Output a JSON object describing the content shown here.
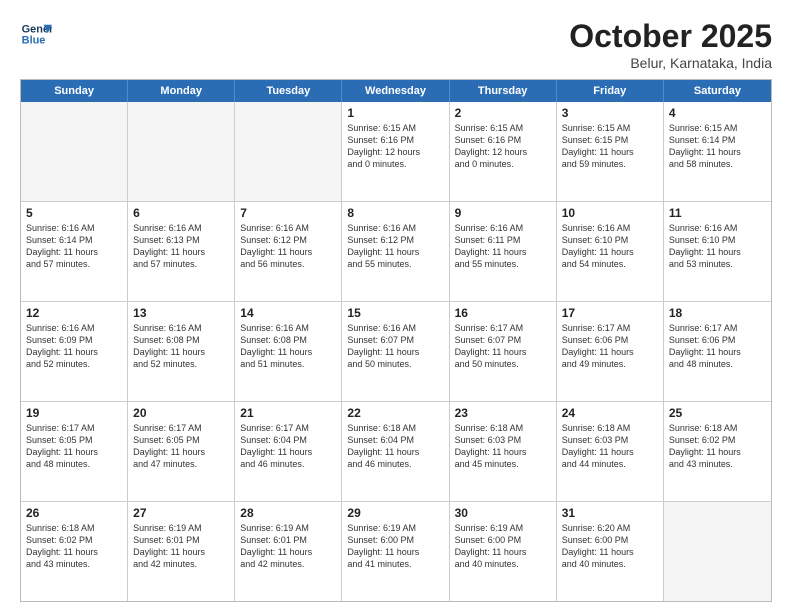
{
  "logo": {
    "line1": "General",
    "line2": "Blue"
  },
  "header": {
    "month": "October 2025",
    "location": "Belur, Karnataka, India"
  },
  "weekdays": [
    "Sunday",
    "Monday",
    "Tuesday",
    "Wednesday",
    "Thursday",
    "Friday",
    "Saturday"
  ],
  "weeks": [
    [
      {
        "day": "",
        "info": ""
      },
      {
        "day": "",
        "info": ""
      },
      {
        "day": "",
        "info": ""
      },
      {
        "day": "1",
        "info": "Sunrise: 6:15 AM\nSunset: 6:16 PM\nDaylight: 12 hours\nand 0 minutes."
      },
      {
        "day": "2",
        "info": "Sunrise: 6:15 AM\nSunset: 6:16 PM\nDaylight: 12 hours\nand 0 minutes."
      },
      {
        "day": "3",
        "info": "Sunrise: 6:15 AM\nSunset: 6:15 PM\nDaylight: 11 hours\nand 59 minutes."
      },
      {
        "day": "4",
        "info": "Sunrise: 6:15 AM\nSunset: 6:14 PM\nDaylight: 11 hours\nand 58 minutes."
      }
    ],
    [
      {
        "day": "5",
        "info": "Sunrise: 6:16 AM\nSunset: 6:14 PM\nDaylight: 11 hours\nand 57 minutes."
      },
      {
        "day": "6",
        "info": "Sunrise: 6:16 AM\nSunset: 6:13 PM\nDaylight: 11 hours\nand 57 minutes."
      },
      {
        "day": "7",
        "info": "Sunrise: 6:16 AM\nSunset: 6:12 PM\nDaylight: 11 hours\nand 56 minutes."
      },
      {
        "day": "8",
        "info": "Sunrise: 6:16 AM\nSunset: 6:12 PM\nDaylight: 11 hours\nand 55 minutes."
      },
      {
        "day": "9",
        "info": "Sunrise: 6:16 AM\nSunset: 6:11 PM\nDaylight: 11 hours\nand 55 minutes."
      },
      {
        "day": "10",
        "info": "Sunrise: 6:16 AM\nSunset: 6:10 PM\nDaylight: 11 hours\nand 54 minutes."
      },
      {
        "day": "11",
        "info": "Sunrise: 6:16 AM\nSunset: 6:10 PM\nDaylight: 11 hours\nand 53 minutes."
      }
    ],
    [
      {
        "day": "12",
        "info": "Sunrise: 6:16 AM\nSunset: 6:09 PM\nDaylight: 11 hours\nand 52 minutes."
      },
      {
        "day": "13",
        "info": "Sunrise: 6:16 AM\nSunset: 6:08 PM\nDaylight: 11 hours\nand 52 minutes."
      },
      {
        "day": "14",
        "info": "Sunrise: 6:16 AM\nSunset: 6:08 PM\nDaylight: 11 hours\nand 51 minutes."
      },
      {
        "day": "15",
        "info": "Sunrise: 6:16 AM\nSunset: 6:07 PM\nDaylight: 11 hours\nand 50 minutes."
      },
      {
        "day": "16",
        "info": "Sunrise: 6:17 AM\nSunset: 6:07 PM\nDaylight: 11 hours\nand 50 minutes."
      },
      {
        "day": "17",
        "info": "Sunrise: 6:17 AM\nSunset: 6:06 PM\nDaylight: 11 hours\nand 49 minutes."
      },
      {
        "day": "18",
        "info": "Sunrise: 6:17 AM\nSunset: 6:06 PM\nDaylight: 11 hours\nand 48 minutes."
      }
    ],
    [
      {
        "day": "19",
        "info": "Sunrise: 6:17 AM\nSunset: 6:05 PM\nDaylight: 11 hours\nand 48 minutes."
      },
      {
        "day": "20",
        "info": "Sunrise: 6:17 AM\nSunset: 6:05 PM\nDaylight: 11 hours\nand 47 minutes."
      },
      {
        "day": "21",
        "info": "Sunrise: 6:17 AM\nSunset: 6:04 PM\nDaylight: 11 hours\nand 46 minutes."
      },
      {
        "day": "22",
        "info": "Sunrise: 6:18 AM\nSunset: 6:04 PM\nDaylight: 11 hours\nand 46 minutes."
      },
      {
        "day": "23",
        "info": "Sunrise: 6:18 AM\nSunset: 6:03 PM\nDaylight: 11 hours\nand 45 minutes."
      },
      {
        "day": "24",
        "info": "Sunrise: 6:18 AM\nSunset: 6:03 PM\nDaylight: 11 hours\nand 44 minutes."
      },
      {
        "day": "25",
        "info": "Sunrise: 6:18 AM\nSunset: 6:02 PM\nDaylight: 11 hours\nand 43 minutes."
      }
    ],
    [
      {
        "day": "26",
        "info": "Sunrise: 6:18 AM\nSunset: 6:02 PM\nDaylight: 11 hours\nand 43 minutes."
      },
      {
        "day": "27",
        "info": "Sunrise: 6:19 AM\nSunset: 6:01 PM\nDaylight: 11 hours\nand 42 minutes."
      },
      {
        "day": "28",
        "info": "Sunrise: 6:19 AM\nSunset: 6:01 PM\nDaylight: 11 hours\nand 42 minutes."
      },
      {
        "day": "29",
        "info": "Sunrise: 6:19 AM\nSunset: 6:00 PM\nDaylight: 11 hours\nand 41 minutes."
      },
      {
        "day": "30",
        "info": "Sunrise: 6:19 AM\nSunset: 6:00 PM\nDaylight: 11 hours\nand 40 minutes."
      },
      {
        "day": "31",
        "info": "Sunrise: 6:20 AM\nSunset: 6:00 PM\nDaylight: 11 hours\nand 40 minutes."
      },
      {
        "day": "",
        "info": ""
      }
    ]
  ]
}
